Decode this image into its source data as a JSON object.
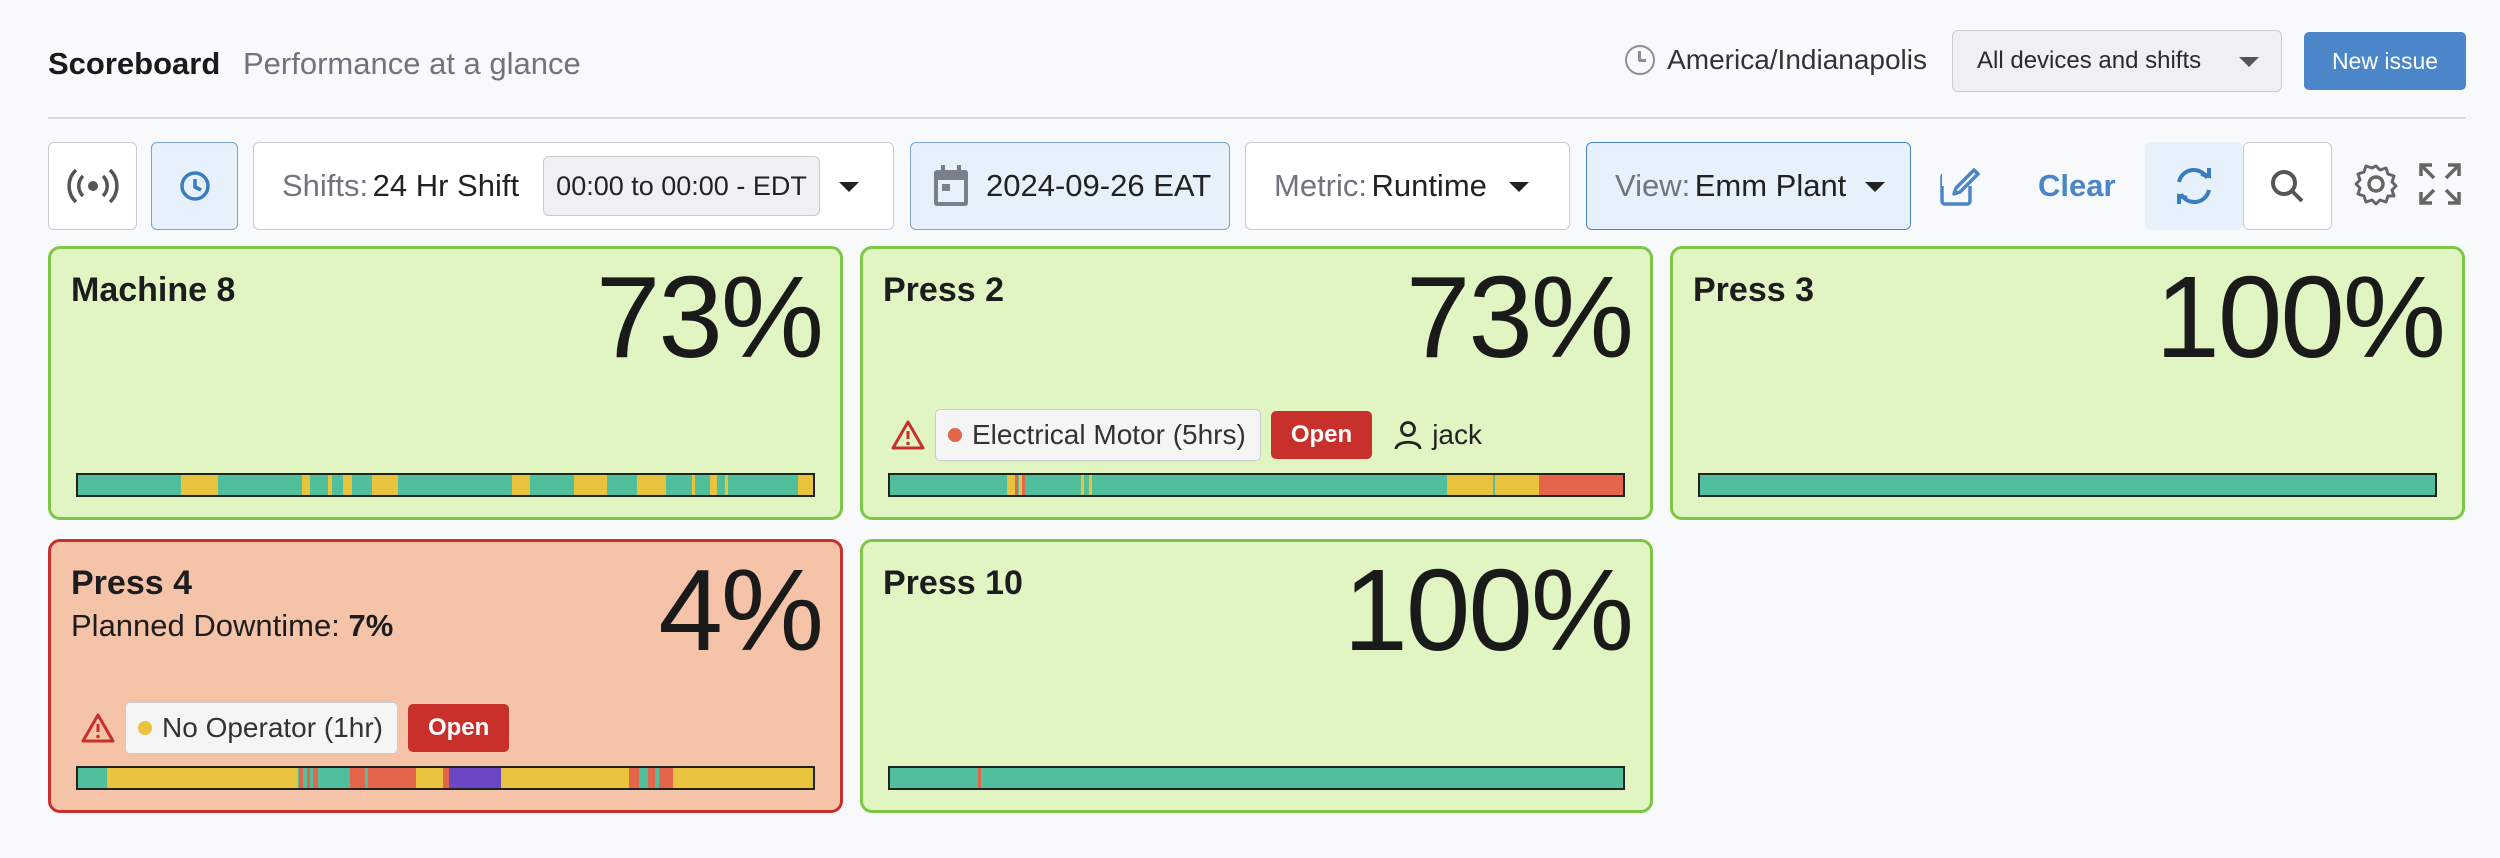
{
  "header": {
    "title": "Scoreboard",
    "subtitle": "Performance at a glance",
    "timezone": "America/Indianapolis",
    "device_filter": "All devices and shifts",
    "new_issue": "New issue"
  },
  "toolbar": {
    "shifts_label": "Shifts:",
    "shifts_value": "24 Hr Shift",
    "shift_time": "00:00 to 00:00 - EDT",
    "date": "2024-09-26",
    "date_tz": "EAT",
    "metric_label": "Metric:",
    "metric_value": "Runtime",
    "view_label": "View:",
    "view_value": "Emm Plant",
    "clear": "Clear"
  },
  "colors": {
    "running": "#4fbf9c",
    "idle": "#e9c23e",
    "down": "#e4654a",
    "planned": "#6a47c4",
    "good_bg": "#e0f5c2",
    "good_border": "#7dc648",
    "bad_bg": "#f5c3a8",
    "bad_border": "#c8302c",
    "accent": "#4a86c8"
  },
  "cards": [
    {
      "name": "Machine 8",
      "value": "73%",
      "status": "good",
      "timeline": [
        [
          0.14,
          0.19,
          "idle"
        ],
        [
          0.305,
          0.315,
          "idle"
        ],
        [
          0.34,
          0.345,
          "idle"
        ],
        [
          0.36,
          0.373,
          "idle"
        ],
        [
          0.4,
          0.435,
          "idle"
        ],
        [
          0.59,
          0.615,
          "idle"
        ],
        [
          0.675,
          0.72,
          "idle"
        ],
        [
          0.76,
          0.8,
          "idle"
        ],
        [
          0.835,
          0.84,
          "idle"
        ],
        [
          0.86,
          0.87,
          "idle"
        ],
        [
          0.88,
          0.885,
          "idle"
        ],
        [
          0.98,
          1.0,
          "idle"
        ]
      ]
    },
    {
      "name": "Press 2",
      "value": "73%",
      "status": "good",
      "issue": {
        "text": "Electrical Motor (5hrs)",
        "dot": "#e4654a",
        "badge": "Open",
        "user": "jack"
      },
      "timeline": [
        [
          0.16,
          0.17,
          "idle"
        ],
        [
          0.17,
          0.174,
          "down"
        ],
        [
          0.176,
          0.18,
          "idle"
        ],
        [
          0.18,
          0.184,
          "down"
        ],
        [
          0.26,
          0.265,
          "idle"
        ],
        [
          0.272,
          0.276,
          "idle"
        ],
        [
          0.76,
          0.82,
          "idle"
        ],
        [
          0.82,
          0.82,
          "idle"
        ],
        [
          0.825,
          0.885,
          "idle"
        ],
        [
          0.885,
          1.0,
          "down"
        ]
      ]
    },
    {
      "name": "Press 3",
      "value": "100%",
      "status": "good",
      "timeline": []
    },
    {
      "name": "Press 4",
      "value": "4%",
      "status": "bad",
      "planned_label": "Planned Downtime:",
      "planned_value": "7%",
      "issue": {
        "text": "No Operator (1hr)",
        "dot": "#e9c23e",
        "badge": "Open"
      },
      "timeline": [
        [
          0.04,
          0.3,
          "idle"
        ],
        [
          0.3,
          0.306,
          "down"
        ],
        [
          0.312,
          0.316,
          "down"
        ],
        [
          0.32,
          0.326,
          "down"
        ],
        [
          0.37,
          0.39,
          "down"
        ],
        [
          0.395,
          0.42,
          "down"
        ],
        [
          0.42,
          0.46,
          "down"
        ],
        [
          0.46,
          0.497,
          "idle"
        ],
        [
          0.497,
          0.505,
          "down"
        ],
        [
          0.505,
          0.575,
          "planned"
        ],
        [
          0.575,
          0.75,
          "idle"
        ],
        [
          0.75,
          0.763,
          "down"
        ],
        [
          0.775,
          0.785,
          "down"
        ],
        [
          0.79,
          0.81,
          "down"
        ],
        [
          0.81,
          1.0,
          "idle"
        ]
      ]
    },
    {
      "name": "Press 10",
      "value": "100%",
      "status": "good",
      "timeline": [
        [
          0.12,
          0.124,
          "down"
        ]
      ]
    }
  ]
}
